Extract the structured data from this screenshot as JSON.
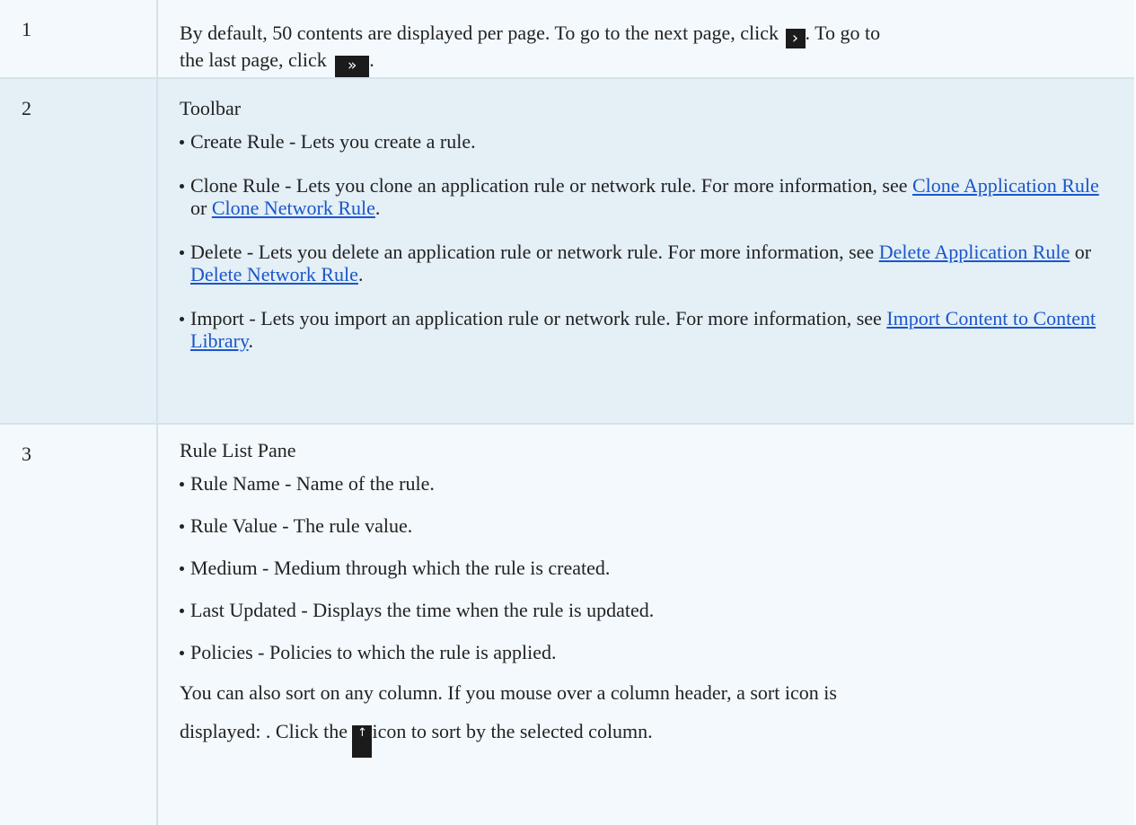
{
  "rows": [
    {
      "number": "1",
      "text_before_next": "By default, 50 contents are displayed per page. To go to the next page, click",
      "text_after_next": ". To go to",
      "text_line2_before_last": "the last page, click",
      "text_after_last": ".",
      "next_icon_glyph": "›",
      "last_icon_glyph": "»",
      "next_icon_name": "chevron-right-icon",
      "last_icon_name": "double-chevron-right-icon"
    },
    {
      "number": "2",
      "title": "Toolbar",
      "items": [
        {
          "text": "Create Rule - Lets you create a rule."
        },
        {
          "text": "Clone Rule - Lets you clone an application rule or network rule. For more information, see",
          "link1": "Clone Application Rule",
          "joiner": "or",
          "link2": "Clone Network Rule",
          "end": "."
        },
        {
          "text": "Delete - Lets you delete an application rule or network rule. For more information, see",
          "link1": "Delete Application Rule",
          "joiner": "or",
          "link2": "Delete Network Rule",
          "end": "."
        },
        {
          "text": "Import - Lets you import an application rule or network rule. For more information, see",
          "link1": "Import Content to Content Library",
          "end": "."
        }
      ]
    },
    {
      "number": "3",
      "title": "Rule List Pane",
      "items": [
        "Rule Name - Name of the rule.",
        "Rule Value - The rule value.",
        "Medium - Medium through which the rule is created.",
        "Last Updated - Displays the time when the rule is updated.",
        "Policies - Policies to which the rule is applied."
      ],
      "sort_line1": "You can also sort on any column. If you mouse over a column header, a sort icon is",
      "sort_line2_before": "displayed: . Click the",
      "sort_line2_after": "icon to sort by the selected column.",
      "sort_icon_glyph": "↑",
      "sort_icon_name": "sort-arrow-up-icon"
    }
  ],
  "colors": {
    "row_light": "#f3f9fd",
    "row_dark": "#e4eff6",
    "link": "#1a56cc",
    "icon_bg": "#1b1b1b"
  }
}
